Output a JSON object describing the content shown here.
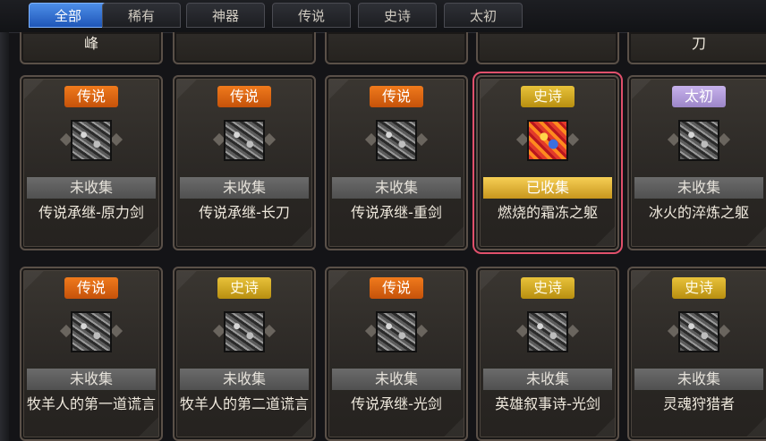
{
  "tabs": [
    {
      "label": "全部",
      "active": true
    },
    {
      "label": "稀有",
      "active": false
    },
    {
      "label": "神器",
      "active": false
    },
    {
      "label": "传说",
      "active": false
    },
    {
      "label": "史诗",
      "active": false
    },
    {
      "label": "太初",
      "active": false
    }
  ],
  "partial_row": [
    "峰",
    "",
    "",
    "",
    "刀"
  ],
  "rows": [
    [
      {
        "rarity": "传说",
        "rarity_class": "legend",
        "status": "未收集",
        "collected": false,
        "name": "传说承继-原力剑",
        "icon": "greatsword-icon"
      },
      {
        "rarity": "传说",
        "rarity_class": "legend",
        "status": "未收集",
        "collected": false,
        "name": "传说承继-长刀",
        "icon": "katana-icon"
      },
      {
        "rarity": "传说",
        "rarity_class": "legend",
        "status": "未收集",
        "collected": false,
        "name": "传说承继-重剑",
        "icon": "heavy-sword-icon"
      },
      {
        "rarity": "史诗",
        "rarity_class": "epic",
        "status": "已收集",
        "collected": true,
        "name": "燃烧的霜冻之躯",
        "icon": "fire-frost-armor-icon"
      },
      {
        "rarity": "太初",
        "rarity_class": "primal",
        "status": "未收集",
        "collected": false,
        "name": "冰火的淬炼之躯",
        "icon": "ice-fire-armor-icon"
      }
    ],
    [
      {
        "rarity": "传说",
        "rarity_class": "legend",
        "status": "未收集",
        "collected": false,
        "name": "牧羊人的第一道谎言",
        "icon": "shepherd-lie-one-icon"
      },
      {
        "rarity": "史诗",
        "rarity_class": "epic",
        "status": "未收集",
        "collected": false,
        "name": "牧羊人的第二道谎言",
        "icon": "shepherd-lie-two-icon"
      },
      {
        "rarity": "传说",
        "rarity_class": "legend",
        "status": "未收集",
        "collected": false,
        "name": "传说承继-光剑",
        "icon": "lightsword-icon"
      },
      {
        "rarity": "史诗",
        "rarity_class": "epic",
        "status": "未收集",
        "collected": false,
        "name": "英雄叙事诗-光剑",
        "icon": "hero-lightsword-icon"
      },
      {
        "rarity": "史诗",
        "rarity_class": "epic",
        "status": "未收集",
        "collected": false,
        "name": "灵魂狩猎者",
        "icon": "soul-hunter-icon"
      }
    ]
  ],
  "selected": {
    "row": 0,
    "col": 3
  }
}
